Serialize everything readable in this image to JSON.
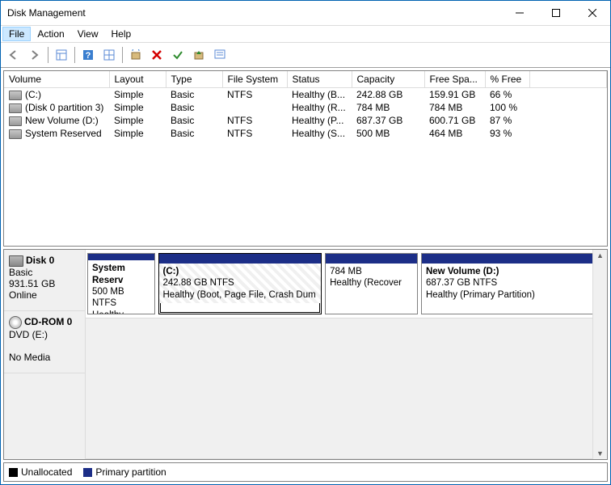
{
  "window": {
    "title": "Disk Management"
  },
  "menu": [
    "File",
    "Action",
    "View",
    "Help"
  ],
  "columns": [
    "Volume",
    "Layout",
    "Type",
    "File System",
    "Status",
    "Capacity",
    "Free Spa...",
    "% Free"
  ],
  "volumes": [
    {
      "name": "(C:)",
      "layout": "Simple",
      "type": "Basic",
      "fs": "NTFS",
      "status": "Healthy (B...",
      "capacity": "242.88 GB",
      "free": "159.91 GB",
      "pct": "66 %"
    },
    {
      "name": "(Disk 0 partition 3)",
      "layout": "Simple",
      "type": "Basic",
      "fs": "",
      "status": "Healthy (R...",
      "capacity": "784 MB",
      "free": "784 MB",
      "pct": "100 %"
    },
    {
      "name": "New Volume (D:)",
      "layout": "Simple",
      "type": "Basic",
      "fs": "NTFS",
      "status": "Healthy (P...",
      "capacity": "687.37 GB",
      "free": "600.71 GB",
      "pct": "87 %"
    },
    {
      "name": "System Reserved",
      "layout": "Simple",
      "type": "Basic",
      "fs": "NTFS",
      "status": "Healthy (S...",
      "capacity": "500 MB",
      "free": "464 MB",
      "pct": "93 %"
    }
  ],
  "disks": [
    {
      "name": "Disk 0",
      "type": "Basic",
      "size": "931.51 GB",
      "status": "Online"
    },
    {
      "name": "CD-ROM 0",
      "type": "DVD (E:)",
      "status": "No Media"
    }
  ],
  "partitions": [
    {
      "title": "System Reserv",
      "line2": "500 MB NTFS",
      "line3": "Healthy (System",
      "w": 13,
      "selected": false
    },
    {
      "title": "(C:)",
      "line2": "242.88 GB NTFS",
      "line3": "Healthy (Boot, Page File, Crash Dum",
      "w": 32,
      "selected": true
    },
    {
      "title": "",
      "line2": "784 MB",
      "line3": "Healthy (Recover",
      "w": 18,
      "selected": false
    },
    {
      "title": "New Volume  (D:)",
      "line2": "687.37 GB NTFS",
      "line3": "Healthy (Primary Partition)",
      "w": 37,
      "selected": false
    }
  ],
  "legend": [
    "Unallocated",
    "Primary partition"
  ]
}
